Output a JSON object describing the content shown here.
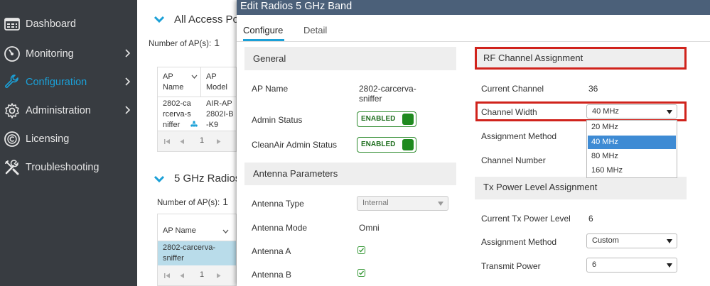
{
  "sidebar": {
    "items": [
      {
        "label": "Dashboard",
        "icon": "dashboard-icon",
        "has_chevron": false
      },
      {
        "label": "Monitoring",
        "icon": "monitoring-icon",
        "has_chevron": true
      },
      {
        "label": "Configuration",
        "icon": "wrench-icon",
        "has_chevron": true,
        "active": true
      },
      {
        "label": "Administration",
        "icon": "gear-icon",
        "has_chevron": true
      },
      {
        "label": "Licensing",
        "icon": "licensing-icon",
        "has_chevron": false
      },
      {
        "label": "Troubleshooting",
        "icon": "tools-icon",
        "has_chevron": false
      }
    ],
    "active_color": "#1ba0d7"
  },
  "background": {
    "section1": {
      "title": "All Access Po",
      "count_label": "Number of AP(s):",
      "count": "1",
      "headers": [
        "AP Name",
        "AP Model"
      ],
      "row": {
        "ap_name": "2802-carcerva-sniffer",
        "ap_model": "AIR-AP2802I-B-K9"
      },
      "page": "1"
    },
    "section2": {
      "title": "5 GHz Radios",
      "count_label": "Number of AP(s):",
      "count": "1",
      "header": "AP Name",
      "row": {
        "ap_name": "2802-carcerva-sniffer"
      },
      "page": "1"
    }
  },
  "modal": {
    "title": "Edit Radios 5 GHz Band",
    "tabs": [
      "Configure",
      "Detail"
    ],
    "general": {
      "heading": "General",
      "ap_name_label": "AP Name",
      "ap_name_value": "2802-carcerva-sniffer",
      "admin_status_label": "Admin Status",
      "admin_status_value": "ENABLED",
      "cleanair_label": "CleanAir Admin Status",
      "cleanair_value": "ENABLED"
    },
    "antenna": {
      "heading": "Antenna Parameters",
      "type_label": "Antenna Type",
      "type_value": "Internal",
      "mode_label": "Antenna Mode",
      "mode_value": "Omni",
      "a_label": "Antenna A",
      "a_checked": true,
      "b_label": "Antenna B",
      "b_checked": true
    },
    "rf": {
      "heading": "RF Channel Assignment",
      "current_channel_label": "Current Channel",
      "current_channel_value": "36",
      "channel_width_label": "Channel Width",
      "channel_width_value": "40 MHz",
      "channel_width_options": [
        "20 MHz",
        "40 MHz",
        "80 MHz",
        "160 MHz"
      ],
      "channel_width_selected_index": 1,
      "assignment_method_label": "Assignment Method",
      "channel_number_label": "Channel Number"
    },
    "tx": {
      "heading": "Tx Power Level Assignment",
      "current_level_label": "Current Tx Power Level",
      "current_level_value": "6",
      "assignment_method_label": "Assignment Method",
      "assignment_method_value": "Custom",
      "transmit_power_label": "Transmit Power",
      "transmit_power_value": "6"
    }
  },
  "colors": {
    "sidebar_bg": "#383c41",
    "modal_header_bg": "#4b6079",
    "highlight": "#d0231c",
    "enabled_green": "#1f8a1f",
    "selected_option": "#3e8bd4"
  }
}
